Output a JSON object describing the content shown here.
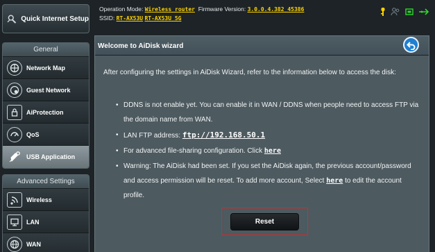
{
  "sidebar": {
    "quick_setup_label": "Quick Internet Setup",
    "general_heading": "General",
    "general_items": [
      {
        "label": "Network Map",
        "icon": "network-map-icon"
      },
      {
        "label": "Guest Network",
        "icon": "guest-network-icon"
      },
      {
        "label": "AiProtection",
        "icon": "aiprotection-icon"
      },
      {
        "label": "QoS",
        "icon": "qos-icon"
      },
      {
        "label": "USB Application",
        "icon": "usb-application-icon",
        "active": true
      }
    ],
    "advanced_heading": "Advanced Settings",
    "advanced_items": [
      {
        "label": "Wireless",
        "icon": "wireless-icon"
      },
      {
        "label": "LAN",
        "icon": "lan-icon"
      },
      {
        "label": "WAN",
        "icon": "wan-icon"
      }
    ]
  },
  "header": {
    "operation_mode_label": "Operation Mode:",
    "operation_mode_value": "Wireless router",
    "firmware_label": "Firmware Version:",
    "firmware_value": "3.0.0.4.382_45386",
    "ssid_label": "SSID:",
    "ssid_1": "RT-AX53U",
    "ssid_2": "RT-AX53U_5G",
    "status_icons": [
      "usb-status-icon",
      "users-status-icon",
      "internet-status-icon",
      "usb-connection-icon"
    ]
  },
  "panel": {
    "title": "Welcome to AiDisk wizard",
    "intro": "After configuring the settings in AiDisk Wizard, refer to the information below to access the disk:",
    "ddns_text": "DDNS is not enable yet. You can enable it in WAN / DDNS when people need to access FTP via the domain name from WAN.",
    "ftp_label": "LAN FTP address:",
    "ftp_address": "ftp://192.168.50.1",
    "advanced_text": "For advanced file-sharing configuration. Click",
    "advanced_link": "here",
    "warning_text": "Warning: The AiDisk had been set. If you set the AiDisk again, the previous account/password and access permission will be reset. To add more account, Select",
    "warning_link": "here",
    "warning_suffix": "to edit the account profile.",
    "reset_label": "Reset"
  },
  "colors": {
    "accent_link": "#ffd400",
    "highlight_border": "#e52424",
    "back_button": "#1f7fd1"
  }
}
